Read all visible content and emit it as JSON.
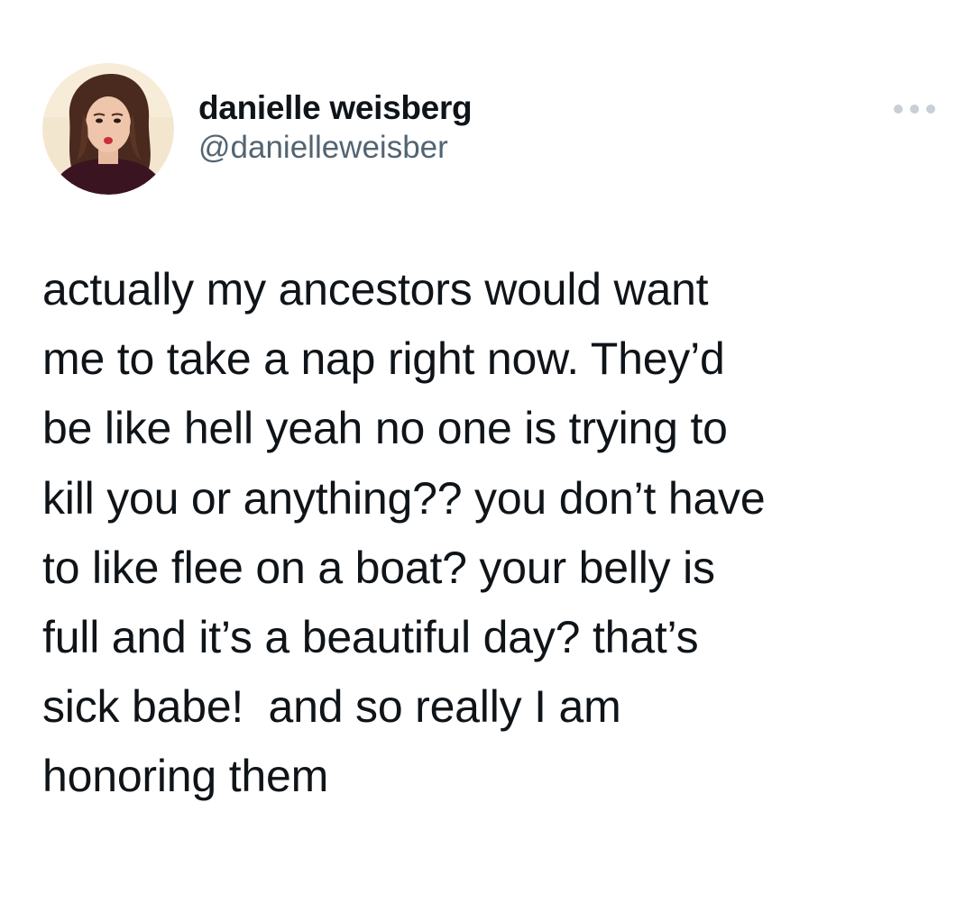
{
  "tweet": {
    "author": {
      "display_name": "danielle weisberg",
      "handle": "@danielleweisber",
      "avatar_icon": "user-avatar"
    },
    "more_icon": "more-dots-icon",
    "text_lines": [
      "actually my ancestors would want",
      "me to take a nap right now. They’d",
      "be like hell yeah no one is trying to",
      "kill you or anything?? you don’t have",
      "to like flee on a boat? your belly is",
      "full and it’s a beautiful day? that’s",
      "sick babe!  and so really I am",
      "honoring them"
    ]
  },
  "colors": {
    "text_primary": "#0f1419",
    "text_secondary": "#536471",
    "background": "#ffffff",
    "icon_muted": "#c9cfd4"
  }
}
